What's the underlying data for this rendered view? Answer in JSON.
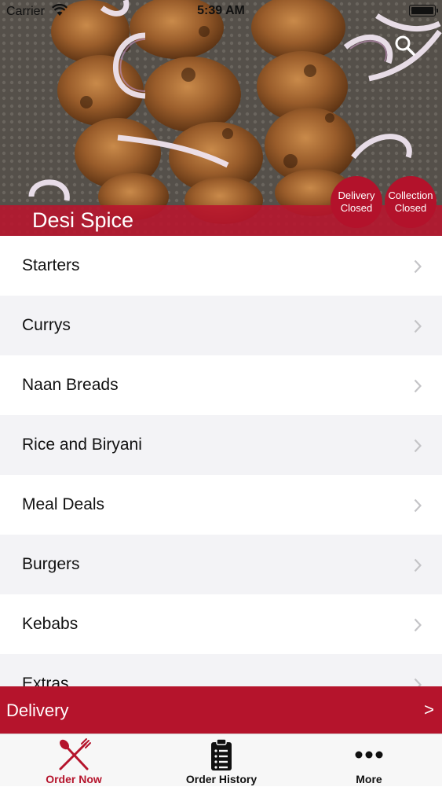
{
  "status_bar": {
    "carrier": "Carrier",
    "time": "5:39 AM"
  },
  "restaurant": {
    "name": "Desi Spice",
    "delivery_status": {
      "line1": "Delivery",
      "line2": "Closed"
    },
    "collection_status": {
      "line1": "Collection",
      "line2": "Closed"
    }
  },
  "menu": {
    "categories": [
      "Starters",
      "Currys",
      "Naan Breads",
      "Rice and Biryani",
      "Meal Deals",
      "Burgers",
      "Kebabs",
      "Extras"
    ]
  },
  "order_type": {
    "label": "Delivery",
    "arrow": ">"
  },
  "tabs": [
    {
      "label": "Order Now",
      "icon": "fork-knife-icon",
      "active": true
    },
    {
      "label": "Order History",
      "icon": "clipboard-icon",
      "active": false
    },
    {
      "label": "More",
      "icon": "ellipsis-icon",
      "active": false
    }
  ],
  "colors": {
    "accent": "#b5142c",
    "row_alt": "#f3f3f6"
  }
}
